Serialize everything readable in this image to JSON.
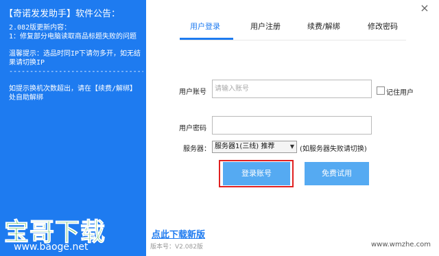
{
  "announcement": {
    "title": "【奇诺发发助手】软件公告：",
    "lines": [
      "2.082版更新内容：",
      "1：修复部分电脑读取商品标题失败的问题",
      "",
      "温馨提示：选品时同IP下请勿多开，如无结果请切换IP",
      "--------------------------------------",
      "",
      "如提示换机次数超出，请在【续费/解绑】处自助解绑"
    ]
  },
  "window": {
    "close_label": "×"
  },
  "tabs": [
    {
      "label": "用户登录",
      "active": true
    },
    {
      "label": "用户注册",
      "active": false
    },
    {
      "label": "续费/解绑",
      "active": false
    },
    {
      "label": "修改密码",
      "active": false
    }
  ],
  "form": {
    "account_label": "用户账号",
    "account_placeholder": "请输入账号",
    "account_value": "",
    "remember_label": "记住用户",
    "remember_checked": false,
    "password_label": "用户密码",
    "password_value": "",
    "server_label": "服务器：",
    "server_selected": "服务器1(三线) 推荐",
    "server_hint": "(如服务器失败请切换)"
  },
  "buttons": {
    "login": "登录账号",
    "trial": "免费试用"
  },
  "footer": {
    "download_link": "点此下载新版",
    "version": "版本号：V2.082版"
  },
  "overlays": {
    "logo_text": "宝哥下载",
    "logo_url": "www.baoge.net",
    "watermark": "www.wmzhe.com"
  },
  "colors": {
    "primary_blue": "#1e7bf0",
    "button_blue": "#55aaf2",
    "highlight_red": "#e02020",
    "logo_green": "#43b14b"
  }
}
